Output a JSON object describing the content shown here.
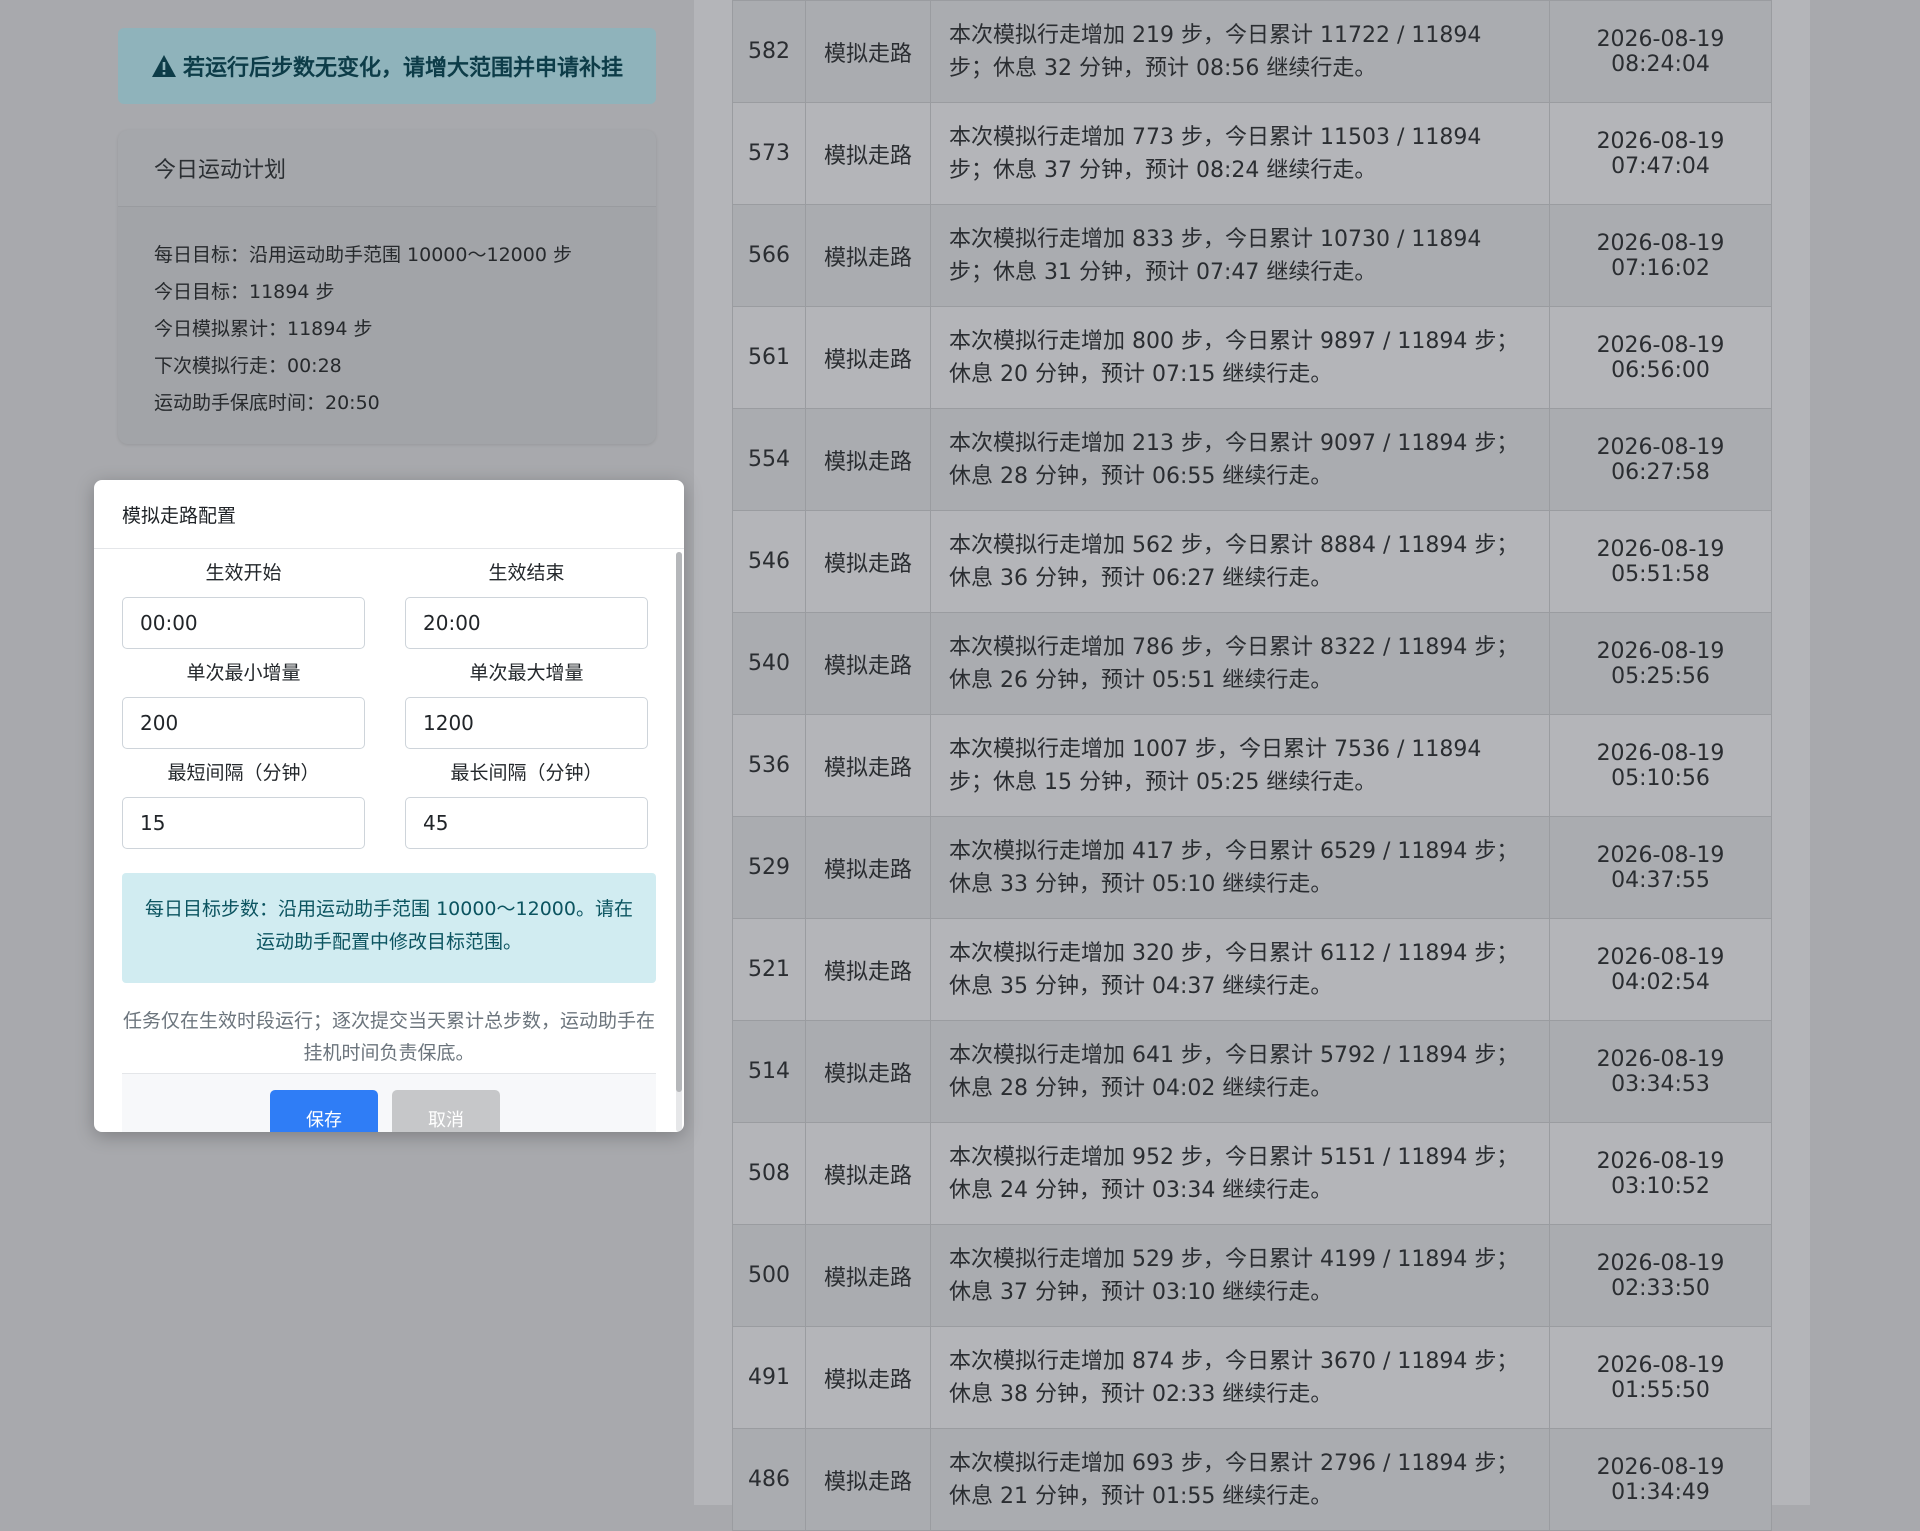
{
  "alert": {
    "icon": "warning-triangle-icon",
    "text": "若运行后步数无变化，请增大范围并申请补挂"
  },
  "plan": {
    "title": "今日运动计划",
    "lines": [
      "每日目标：沿用运动助手范围 10000～12000 步",
      "今日目标：11894 步",
      "今日模拟累计：11894 步",
      "下次模拟行走：00:28",
      "运动助手保底时间：20:50"
    ]
  },
  "log_rows": [
    {
      "id": "582",
      "type": "模拟走路",
      "desc": "本次模拟行走增加 219 步，今日累计 11722 / 11894 步；休息 32 分钟，预计 08:56 继续行走。",
      "time": "2026-08-19 08:24:04"
    },
    {
      "id": "573",
      "type": "模拟走路",
      "desc": "本次模拟行走增加 773 步，今日累计 11503 / 11894 步；休息 37 分钟，预计 08:24 继续行走。",
      "time": "2026-08-19 07:47:04"
    },
    {
      "id": "566",
      "type": "模拟走路",
      "desc": "本次模拟行走增加 833 步，今日累计 10730 / 11894 步；休息 31 分钟，预计 07:47 继续行走。",
      "time": "2026-08-19 07:16:02"
    },
    {
      "id": "561",
      "type": "模拟走路",
      "desc": "本次模拟行走增加 800 步，今日累计 9897 / 11894 步；休息 20 分钟，预计 07:15 继续行走。",
      "time": "2026-08-19 06:56:00"
    },
    {
      "id": "554",
      "type": "模拟走路",
      "desc": "本次模拟行走增加 213 步，今日累计 9097 / 11894 步；休息 28 分钟，预计 06:55 继续行走。",
      "time": "2026-08-19 06:27:58"
    },
    {
      "id": "546",
      "type": "模拟走路",
      "desc": "本次模拟行走增加 562 步，今日累计 8884 / 11894 步；休息 36 分钟，预计 06:27 继续行走。",
      "time": "2026-08-19 05:51:58"
    },
    {
      "id": "540",
      "type": "模拟走路",
      "desc": "本次模拟行走增加 786 步，今日累计 8322 / 11894 步；休息 26 分钟，预计 05:51 继续行走。",
      "time": "2026-08-19 05:25:56"
    },
    {
      "id": "536",
      "type": "模拟走路",
      "desc": "本次模拟行走增加 1007 步，今日累计 7536 / 11894 步；休息 15 分钟，预计 05:25 继续行走。",
      "time": "2026-08-19 05:10:56"
    },
    {
      "id": "529",
      "type": "模拟走路",
      "desc": "本次模拟行走增加 417 步，今日累计 6529 / 11894 步；休息 33 分钟，预计 05:10 继续行走。",
      "time": "2026-08-19 04:37:55"
    },
    {
      "id": "521",
      "type": "模拟走路",
      "desc": "本次模拟行走增加 320 步，今日累计 6112 / 11894 步；休息 35 分钟，预计 04:37 继续行走。",
      "time": "2026-08-19 04:02:54"
    },
    {
      "id": "514",
      "type": "模拟走路",
      "desc": "本次模拟行走增加 641 步，今日累计 5792 / 11894 步；休息 28 分钟，预计 04:02 继续行走。",
      "time": "2026-08-19 03:34:53"
    },
    {
      "id": "508",
      "type": "模拟走路",
      "desc": "本次模拟行走增加 952 步，今日累计 5151 / 11894 步；休息 24 分钟，预计 03:34 继续行走。",
      "time": "2026-08-19 03:10:52"
    },
    {
      "id": "500",
      "type": "模拟走路",
      "desc": "本次模拟行走增加 529 步，今日累计 4199 / 11894 步；休息 37 分钟，预计 03:10 继续行走。",
      "time": "2026-08-19 02:33:50"
    },
    {
      "id": "491",
      "type": "模拟走路",
      "desc": "本次模拟行走增加 874 步，今日累计 3670 / 11894 步；休息 38 分钟，预计 02:33 继续行走。",
      "time": "2026-08-19 01:55:50"
    },
    {
      "id": "486",
      "type": "模拟走路",
      "desc": "本次模拟行走增加 693 步，今日累计 2796 / 11894 步；休息 21 分钟，预计 01:55 继续行走。",
      "time": "2026-08-19 01:34:49"
    }
  ],
  "modal": {
    "title": "模拟走路配置",
    "fields": {
      "start": {
        "label": "生效开始",
        "value": "00:00"
      },
      "end": {
        "label": "生效结束",
        "value": "20:00"
      },
      "min_inc": {
        "label": "单次最小增量",
        "value": "200"
      },
      "max_inc": {
        "label": "单次最大增量",
        "value": "1200"
      },
      "min_gap": {
        "label": "最短间隔（分钟）",
        "value": "15"
      },
      "max_gap": {
        "label": "最长间隔（分钟）",
        "value": "45"
      }
    },
    "info": "每日目标步数：沿用运动助手范围 10000～12000。请在运动助手配置中修改目标范围。",
    "hint": "任务仅在生效时段运行；逐次提交当天累计总步数，运动助手在挂机时间负责保底。",
    "save_label": "保存",
    "cancel_label": "取消"
  }
}
